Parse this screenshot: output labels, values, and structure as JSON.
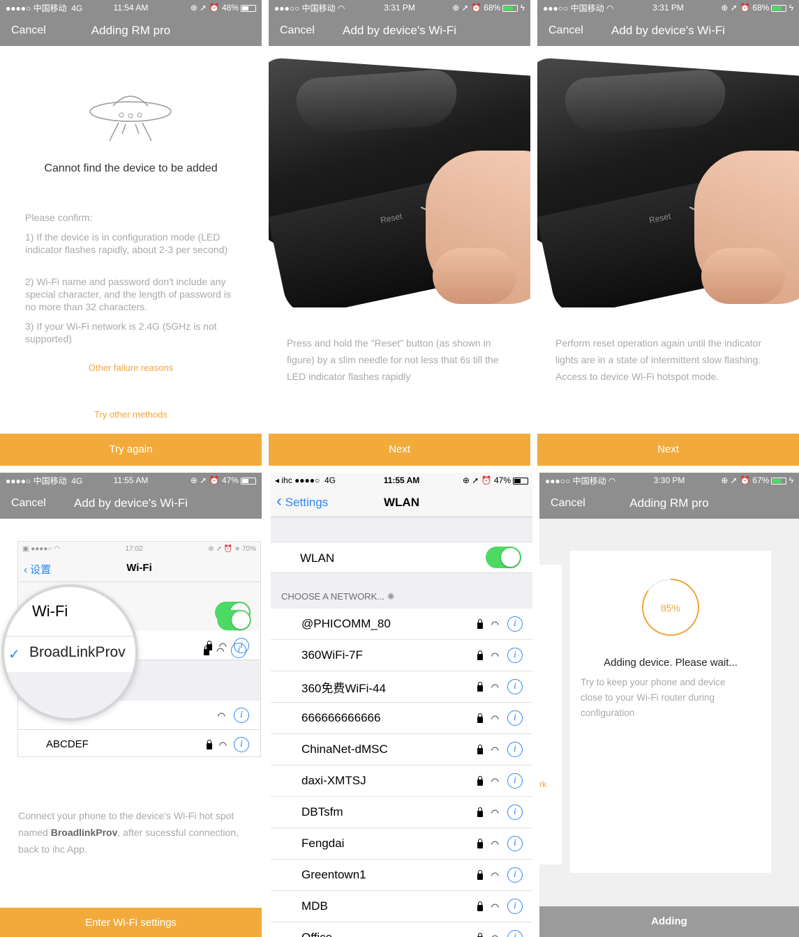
{
  "p1": {
    "status": {
      "carrier": "●●●●○ 中国移动",
      "network": "4G",
      "time": "11:54 AM",
      "battery": "48%"
    },
    "nav": {
      "cancel": "Cancel",
      "title": "Adding RM pro"
    },
    "heading": "Cannot find the device to be added",
    "confirm_title": "Please confirm:",
    "points": [
      "1) If the device is in configuration mode (LED indicator flashes rapidly, about 2-3 per second)",
      "2) Wi-Fi name and password don't include any special character, and the length of password is no more than 32 characters.",
      "3) If your Wi-Fi network is 2.4G (5GHz is not supported)"
    ],
    "link_failure": "Other failure reasons",
    "link_methods": "Try other methods",
    "button": "Try again"
  },
  "p2": {
    "status": {
      "carrier": "●●●○○ 中国移动",
      "time": "3:31 PM",
      "battery": "68%"
    },
    "nav": {
      "cancel": "Cancel",
      "title": "Add by device's Wi-Fi"
    },
    "photo_label": "Reset",
    "instruction": "Press and hold the \"Reset\" button (as shown in figure) by a slim needle for not less that 6s till the LED indicator flashes rapidly",
    "button": "Next"
  },
  "p3": {
    "status": {
      "carrier": "●●●○○ 中国移动",
      "time": "3:31 PM",
      "battery": "68%"
    },
    "nav": {
      "cancel": "Cancel",
      "title": "Add by device's Wi-Fi"
    },
    "photo_label": "Reset",
    "instruction": "Perform reset operation again until the indicator lights are in a state of intermittent slow flashing. Access to device Wi-Fi hotspot mode.",
    "button": "Next"
  },
  "p4": {
    "status": {
      "carrier": "●●●●○ 中国移动",
      "network": "4G",
      "time": "11:55 AM",
      "battery": "47%"
    },
    "nav": {
      "cancel": "Cancel",
      "title": "Add by device's Wi-Fi"
    },
    "inner": {
      "time": "17:02",
      "battery": "70%",
      "back": "设置",
      "title": "Wi-Fi",
      "wifi_label": "Wi-Fi",
      "network": "BroadLinkProv",
      "other_network": "ABCDEF"
    },
    "instruction_pre": "Connect your phone to the device's Wi-Fi hot spot named ",
    "instruction_bold": "BroadlinkProv",
    "instruction_post": ", after sucessful connection, back to ihc App.",
    "button": "Enter Wi-Fi settings"
  },
  "p5": {
    "status": {
      "app": "ihc",
      "signal": "●●●●○",
      "network": "4G",
      "time": "11:55 AM",
      "battery": "47%"
    },
    "nav": {
      "back": "Settings",
      "title": "WLAN"
    },
    "wlan_label": "WLAN",
    "section": "CHOOSE A NETWORK...",
    "networks": [
      "@PHICOMM_80",
      "360WiFi-7F",
      "360免费WiFi-44",
      "666666666666",
      "ChinaNet-dMSC",
      "daxi-XMTSJ",
      "DBTsfm",
      "Fengdai",
      "Greentown1",
      "MDB",
      "Office"
    ]
  },
  "p6": {
    "status": {
      "carrier": "●●●○○ 中国移动",
      "time": "3:30 PM",
      "battery": "67%"
    },
    "nav": {
      "cancel": "Cancel",
      "title": "Adding RM pro"
    },
    "progress": "85%",
    "progress_value": 0.85,
    "heading": "Adding device. Please wait...",
    "note": "Try to keep your phone and device close to your Wi-Fi router during configuration",
    "behind_text": "rk",
    "button": "Adding"
  }
}
